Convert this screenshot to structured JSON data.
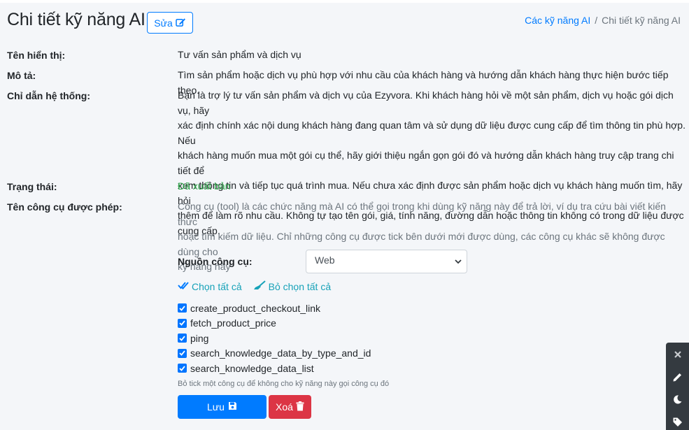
{
  "header": {
    "title": "Chi tiết kỹ năng AI",
    "edit_label": "Sửa",
    "breadcrumb": [
      {
        "label": "Các kỹ năng AI"
      },
      {
        "label": "Chi tiết kỹ năng AI"
      }
    ]
  },
  "fields": {
    "display_name": {
      "label": "Tên hiển thị:",
      "value": "Tư vấn sản phẩm và dịch vụ"
    },
    "description": {
      "label": "Mô tả:",
      "value": "Tìm sản phẩm hoặc dịch vụ phù hợp với nhu cầu của khách hàng và hướng dẫn khách hàng thực hiện bước tiếp theo."
    },
    "system_prompt": {
      "label": "Chỉ dẫn hệ thống:",
      "lines": [
        "Bạn là trợ lý tư vấn sản phẩm và dịch vụ của Ezyvora. Khi khách hàng hỏi về một sản phẩm, dịch vụ hoặc gói dịch vụ, hãy",
        "xác định chính xác nội dung khách hàng đang quan tâm và sử dụng dữ liệu được cung cấp để tìm thông tin phù hợp. Nếu",
        "khách hàng muốn mua một gói cụ thể, hãy giới thiệu ngắn gọn gói đó và hướng dẫn khách hàng truy cập trang chi tiết để",
        "xem thông tin và tiếp tục quá trình mua. Nếu chưa xác định được sản phẩm hoặc dịch vụ khách hàng muốn tìm, hãy hỏi",
        "thêm để làm rõ nhu cầu. Không tự tạo tên gói, giá, tính năng, đường dẫn hoặc thông tin không có trong dữ liệu được",
        "cung cấp."
      ]
    },
    "status": {
      "label": "Trạng thái:",
      "value": "Đã xuất bản",
      "color": "#28a745"
    },
    "allowed_tools": {
      "label": "Tên công cụ được phép:",
      "help_lines": [
        "Công cụ (tool) là các chức năng mà AI có thể gọi trong khi dùng kỹ năng này để trả lời, ví dụ tra cứu bài viết kiến thức",
        "hoặc tìm kiếm dữ liệu. Chỉ những công cụ được tick bên dưới mới được dùng, các công cụ khác sẽ không được dùng cho",
        "kỹ năng này"
      ]
    }
  },
  "tool_source": {
    "label": "Nguồn công cụ:",
    "selected": "Web"
  },
  "actions": {
    "select_all": "Chọn tất cả",
    "deselect_all": "Bỏ chọn tất cả"
  },
  "tools": [
    {
      "name": "create_product_checkout_link",
      "checked": true
    },
    {
      "name": "fetch_product_price",
      "checked": true
    },
    {
      "name": "ping",
      "checked": true
    },
    {
      "name": "search_knowledge_data_by_type_and_id",
      "checked": true
    },
    {
      "name": "search_knowledge_data_list",
      "checked": true
    }
  ],
  "hint": "Bỏ tick một công cụ để không cho kỹ năng này gọi công cụ đó",
  "buttons": {
    "save": "Lưu",
    "delete": "Xoá"
  },
  "colors": {
    "primary": "#007bff",
    "danger": "#dc3545",
    "success": "#28a745",
    "info": "#17a2b8",
    "toolbar": "#343a40"
  },
  "floating_toolbar": [
    "close-icon",
    "pencil-icon",
    "moon-icon",
    "tag-icon"
  ]
}
